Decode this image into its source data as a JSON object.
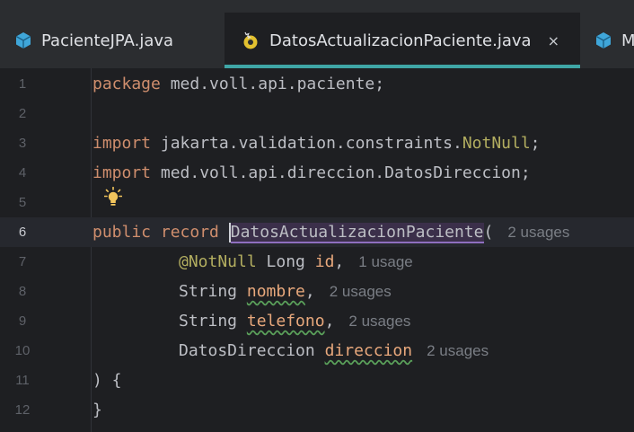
{
  "tabs": [
    {
      "label": "PacienteJPA.java"
    },
    {
      "label": "DatosActualizacionPaciente.java",
      "close": "×"
    },
    {
      "label": "M"
    }
  ],
  "editor": {
    "lines": [
      {
        "n": "1"
      },
      {
        "n": "2"
      },
      {
        "n": "3"
      },
      {
        "n": "4"
      },
      {
        "n": "5"
      },
      {
        "n": "6"
      },
      {
        "n": "7"
      },
      {
        "n": "8"
      },
      {
        "n": "9"
      },
      {
        "n": "10"
      },
      {
        "n": "11"
      },
      {
        "n": "12"
      }
    ],
    "code": {
      "l1_kw": "package",
      "l1_rest": " med.voll.api.paciente;",
      "l3_kw": "import",
      "l3_pkg": " jakarta.validation.constraints.",
      "l3_ann": "NotNull",
      "l3_end": ";",
      "l4_kw": "import",
      "l4_rest": " med.voll.api.direccion.DatosDireccion;",
      "l6_kw1": "public",
      "l6_kw2": "record",
      "l6_name": "DatosActualizacionPaciente",
      "l6_paren": "(",
      "l6_usage": "2 usages",
      "l7_ann": "@NotNull",
      "l7_type": " Long ",
      "l7_param": "id",
      "l7_comma": ",",
      "l7_usage": "1 usage",
      "l8_type": "String ",
      "l8_param": "nombre",
      "l8_comma": ",",
      "l8_usage": "2 usages",
      "l9_type": "String ",
      "l9_param": "telefono",
      "l9_comma": ",",
      "l9_usage": "2 usages",
      "l10_type": "DatosDireccion ",
      "l10_param": "direccion",
      "l10_usage": "2 usages",
      "l11": ") {",
      "l12": "}"
    }
  },
  "colors": {
    "keyword": "#cf8e6d",
    "annotation": "#b3ae60",
    "parameter": "#e8a87c",
    "active_tab_accent": "#3fa6a6"
  },
  "icons": [
    "java-class-icon",
    "record-icon",
    "lightbulb-icon",
    "close-icon"
  ]
}
